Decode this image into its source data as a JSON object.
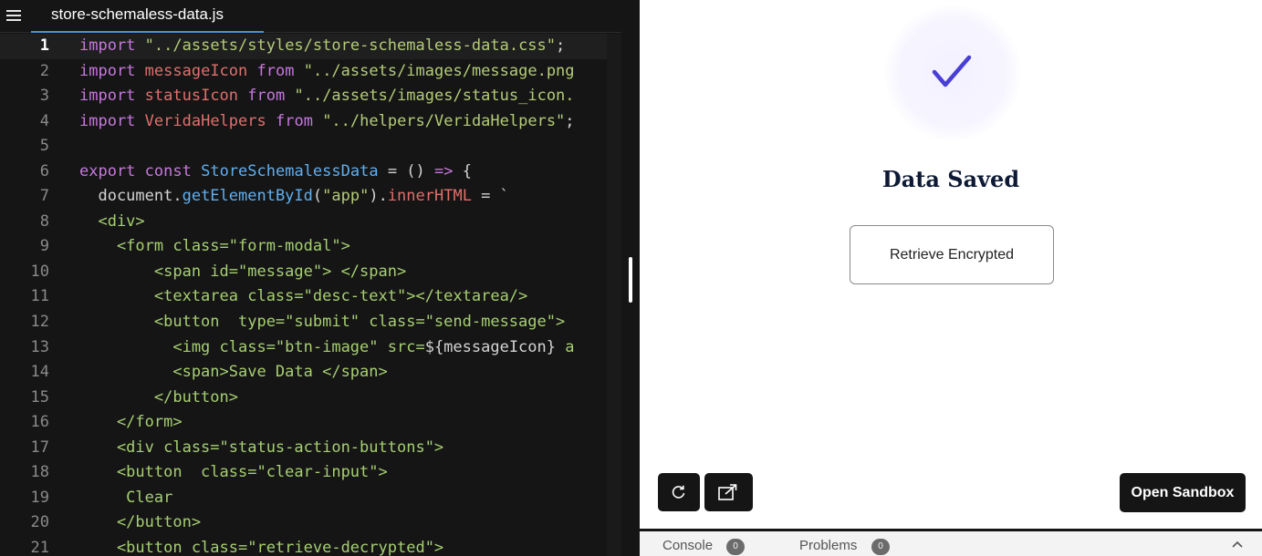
{
  "editor": {
    "tab_title": "store-schemaless-data.js",
    "lines": [
      {
        "n": "1",
        "parts": [
          [
            "kw",
            "import"
          ],
          [
            "plain",
            " "
          ],
          [
            "str",
            "\"../assets/styles/store-schemaless-data.css\""
          ],
          [
            "plain",
            ";"
          ]
        ]
      },
      {
        "n": "2",
        "parts": [
          [
            "kw",
            "import"
          ],
          [
            "plain",
            " "
          ],
          [
            "var",
            "messageIcon"
          ],
          [
            "plain",
            " "
          ],
          [
            "kw",
            "from"
          ],
          [
            "plain",
            " "
          ],
          [
            "str",
            "\"../assets/images/message.png"
          ]
        ]
      },
      {
        "n": "3",
        "parts": [
          [
            "kw",
            "import"
          ],
          [
            "plain",
            " "
          ],
          [
            "var",
            "statusIcon"
          ],
          [
            "plain",
            " "
          ],
          [
            "kw",
            "from"
          ],
          [
            "plain",
            " "
          ],
          [
            "str",
            "\"../assets/images/status_icon."
          ]
        ]
      },
      {
        "n": "4",
        "parts": [
          [
            "kw",
            "import"
          ],
          [
            "plain",
            " "
          ],
          [
            "var",
            "VeridaHelpers"
          ],
          [
            "plain",
            " "
          ],
          [
            "kw",
            "from"
          ],
          [
            "plain",
            " "
          ],
          [
            "str",
            "\"../helpers/VeridaHelpers\""
          ],
          [
            "plain",
            ";"
          ]
        ]
      },
      {
        "n": "5",
        "parts": []
      },
      {
        "n": "6",
        "parts": [
          [
            "kw",
            "export"
          ],
          [
            "plain",
            " "
          ],
          [
            "kw",
            "const"
          ],
          [
            "plain",
            " "
          ],
          [
            "fn",
            "StoreSchemalessData"
          ],
          [
            "plain",
            " = () "
          ],
          [
            "kw",
            "=>"
          ],
          [
            "plain",
            " {"
          ]
        ]
      },
      {
        "n": "7",
        "parts": [
          [
            "plain",
            "  document."
          ],
          [
            "fn",
            "getElementById"
          ],
          [
            "plain",
            "("
          ],
          [
            "str",
            "\"app\""
          ],
          [
            "plain",
            ")."
          ],
          [
            "var",
            "innerHTML"
          ],
          [
            "plain",
            " = `"
          ]
        ]
      },
      {
        "n": "8",
        "parts": [
          [
            "tag",
            "  <div>"
          ]
        ]
      },
      {
        "n": "9",
        "parts": [
          [
            "tag",
            "    <form class=\"form-modal\">"
          ]
        ]
      },
      {
        "n": "10",
        "parts": [
          [
            "tag",
            "        <span id=\"message\"> </span>"
          ]
        ]
      },
      {
        "n": "11",
        "parts": [
          [
            "tag",
            "        <textarea class=\"desc-text\"></textarea/>"
          ]
        ]
      },
      {
        "n": "12",
        "parts": [
          [
            "tag",
            "        <button  type=\"submit\" class=\"send-message\">"
          ]
        ]
      },
      {
        "n": "13",
        "parts": [
          [
            "tag",
            "          <img class=\"btn-image\" src="
          ],
          [
            "plain",
            "${messageIcon}"
          ],
          [
            "tag",
            " a"
          ]
        ]
      },
      {
        "n": "14",
        "parts": [
          [
            "tag",
            "          <span>Save Data </span>"
          ]
        ]
      },
      {
        "n": "15",
        "parts": [
          [
            "tag",
            "        </button>"
          ]
        ]
      },
      {
        "n": "16",
        "parts": [
          [
            "tag",
            "    </form>"
          ]
        ]
      },
      {
        "n": "17",
        "parts": [
          [
            "tag",
            "    <div class=\"status-action-buttons\">"
          ]
        ]
      },
      {
        "n": "18",
        "parts": [
          [
            "tag",
            "    <button  class=\"clear-input\">"
          ]
        ]
      },
      {
        "n": "19",
        "parts": [
          [
            "tag",
            "     Clear"
          ]
        ]
      },
      {
        "n": "20",
        "parts": [
          [
            "tag",
            "    </button>"
          ]
        ]
      },
      {
        "n": "21",
        "parts": [
          [
            "tag",
            "    <button class=\"retrieve-decrypted\">"
          ]
        ]
      }
    ]
  },
  "preview": {
    "title": "Data Saved",
    "retrieve_button": "Retrieve Encrypted",
    "open_sandbox_button": "Open Sandbox",
    "refresh_icon": "refresh-icon",
    "open_new_window_icon": "external-link-icon",
    "check_icon": "check-icon",
    "check_color": "#4a3fd4"
  },
  "bottom_panel": {
    "console_label": "Console",
    "console_count": "0",
    "problems_label": "Problems",
    "problems_count": "0"
  }
}
